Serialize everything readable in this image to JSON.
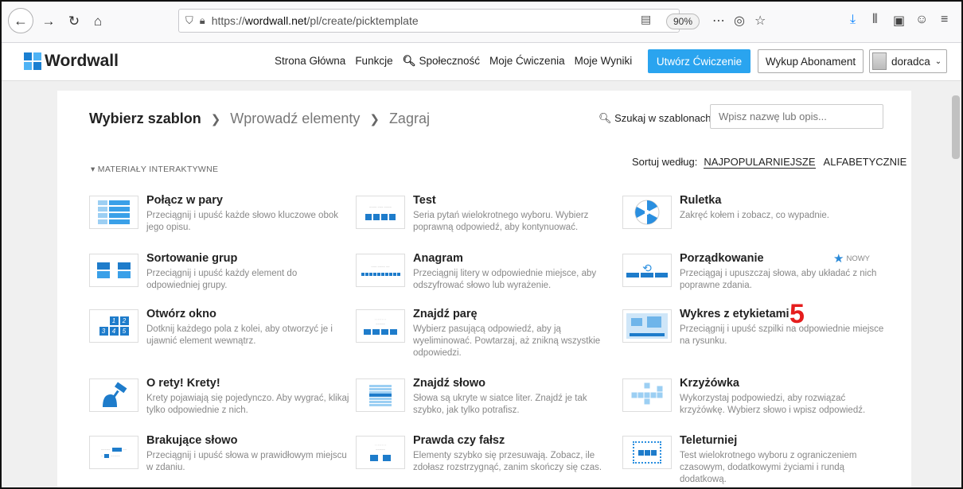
{
  "browser": {
    "url_prefix": "https://",
    "url_host": "wordwall.net",
    "url_path": "/pl/create/picktemplate",
    "zoom": "90%"
  },
  "nav": {
    "logo": "Wordwall",
    "links": [
      "Strona Główna",
      "Funkcje",
      "Społeczność",
      "Moje Ćwiczenia",
      "Moje Wyniki"
    ],
    "create_button": "Utwórz Ćwiczenie",
    "subscribe_button": "Wykup Abonament",
    "username": "doradca"
  },
  "page": {
    "breadcrumb": [
      "Wybierz szablon",
      "Wprowadź elementy",
      "Zagraj"
    ],
    "search_label": "Szukaj w szablonach:",
    "search_placeholder": "Wpisz nazwę lub opis...",
    "section_label": "MATERIAŁY INTERAKTYWNE",
    "sort_label": "Sortuj według:",
    "sort_selected": "NAJPOPULARNIEJSZE",
    "sort_other": "ALFABETYCZNIE",
    "new_badge": "NOWY",
    "annotation": "5"
  },
  "templates": [
    {
      "title": "Połącz w pary",
      "desc": "Przeciągnij i upuść każde słowo kluczowe obok jego opisu."
    },
    {
      "title": "Test",
      "desc": "Seria pytań wielokrotnego wyboru. Wybierz poprawną odpowiedź, aby kontynuować."
    },
    {
      "title": "Ruletka",
      "desc": "Zakręć kołem i zobacz, co wypadnie."
    },
    {
      "title": "Sortowanie grup",
      "desc": "Przeciągnij i upuść każdy element do odpowiedniej grupy."
    },
    {
      "title": "Anagram",
      "desc": "Przeciągnij litery w odpowiednie miejsce, aby odszyfrować słowo lub wyrażenie."
    },
    {
      "title": "Porządkowanie",
      "desc": "Przeciągaj i upuszczaj słowa, aby układać z nich poprawne zdania."
    },
    {
      "title": "Otwórz okno",
      "desc": "Dotknij każdego pola z kolei, aby otworzyć je i ujawnić element wewnątrz."
    },
    {
      "title": "Znajdź parę",
      "desc": "Wybierz pasującą odpowiedź, aby ją wyeliminować. Powtarzaj, aż znikną wszystkie odpowiedzi."
    },
    {
      "title": "Wykres z etykietami",
      "desc": "Przeciągnij i upuść szpilki na odpowiednie miejsce na rysunku."
    },
    {
      "title": "O rety! Krety!",
      "desc": "Krety pojawiają się pojedynczo. Aby wygrać, klikaj tylko odpowiednie z nich."
    },
    {
      "title": "Znajdź słowo",
      "desc": "Słowa są ukryte w siatce liter. Znajdź je tak szybko, jak tylko potrafisz."
    },
    {
      "title": "Krzyżówka",
      "desc": "Wykorzystaj podpowiedzi, aby rozwiązać krzyżówkę. Wybierz słowo i wpisz odpowiedź."
    },
    {
      "title": "Brakujące słowo",
      "desc": "Przeciągnij i upuść słowa w prawidłowym miejscu w zdaniu."
    },
    {
      "title": "Prawda czy fałsz",
      "desc": "Elementy szybko się przesuwają. Zobacz, ile zdołasz rozstrzygnąć, zanim skończy się czas."
    },
    {
      "title": "Teleturniej",
      "desc": "Test wielokrotnego wyboru z ograniczeniem czasowym, dodatkowymi życiami i rundą dodatkową."
    }
  ]
}
